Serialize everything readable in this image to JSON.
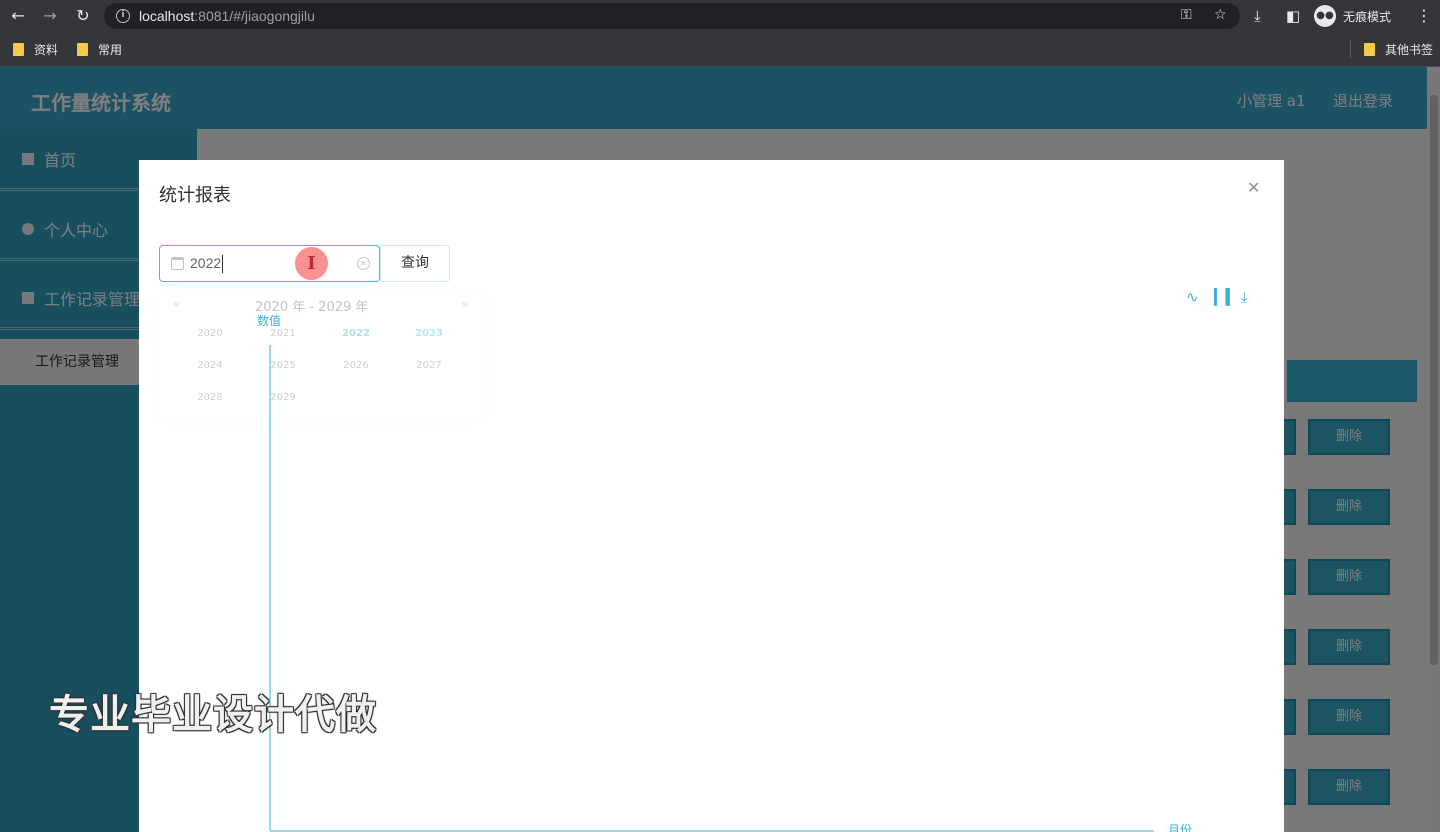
{
  "browser": {
    "url_host": "localhost",
    "url_rest": ":8081/#/jiaogongjilu",
    "incognito_label": "无痕模式",
    "bookmarks": [
      "资料",
      "常用"
    ],
    "other_bookmarks": "其他书签"
  },
  "app": {
    "title": "工作量统计系统",
    "user": "小管理 a1",
    "logout": "退出登录",
    "sidebar": {
      "items": [
        {
          "label": "首页",
          "icon": "home-icon"
        },
        {
          "label": "个人中心",
          "icon": "user-icon"
        },
        {
          "label": "工作记录管理",
          "icon": "clipboard-icon"
        }
      ],
      "sub_item": "工作记录管理"
    },
    "row_action_label": "删除",
    "row_count": 6
  },
  "modal": {
    "title": "统计报表",
    "date_value": "2022",
    "query_button": "查询",
    "year_picker": {
      "header": "2020 年 - 2029 年",
      "years": [
        "2020",
        "2021",
        "2022",
        "2023",
        "2024",
        "2025",
        "2026",
        "2027",
        "2028",
        "2029"
      ],
      "selected": "2022",
      "current": "2023"
    }
  },
  "chart_data": {
    "type": "line",
    "title": "",
    "xlabel": "月份",
    "ylabel": "数值",
    "x": [],
    "series": [],
    "toolbox": [
      "line-chart-icon",
      "bar-chart-icon",
      "download-icon"
    ],
    "axis_color": "#3bb0d0"
  },
  "watermark": "专业毕业设计代做"
}
